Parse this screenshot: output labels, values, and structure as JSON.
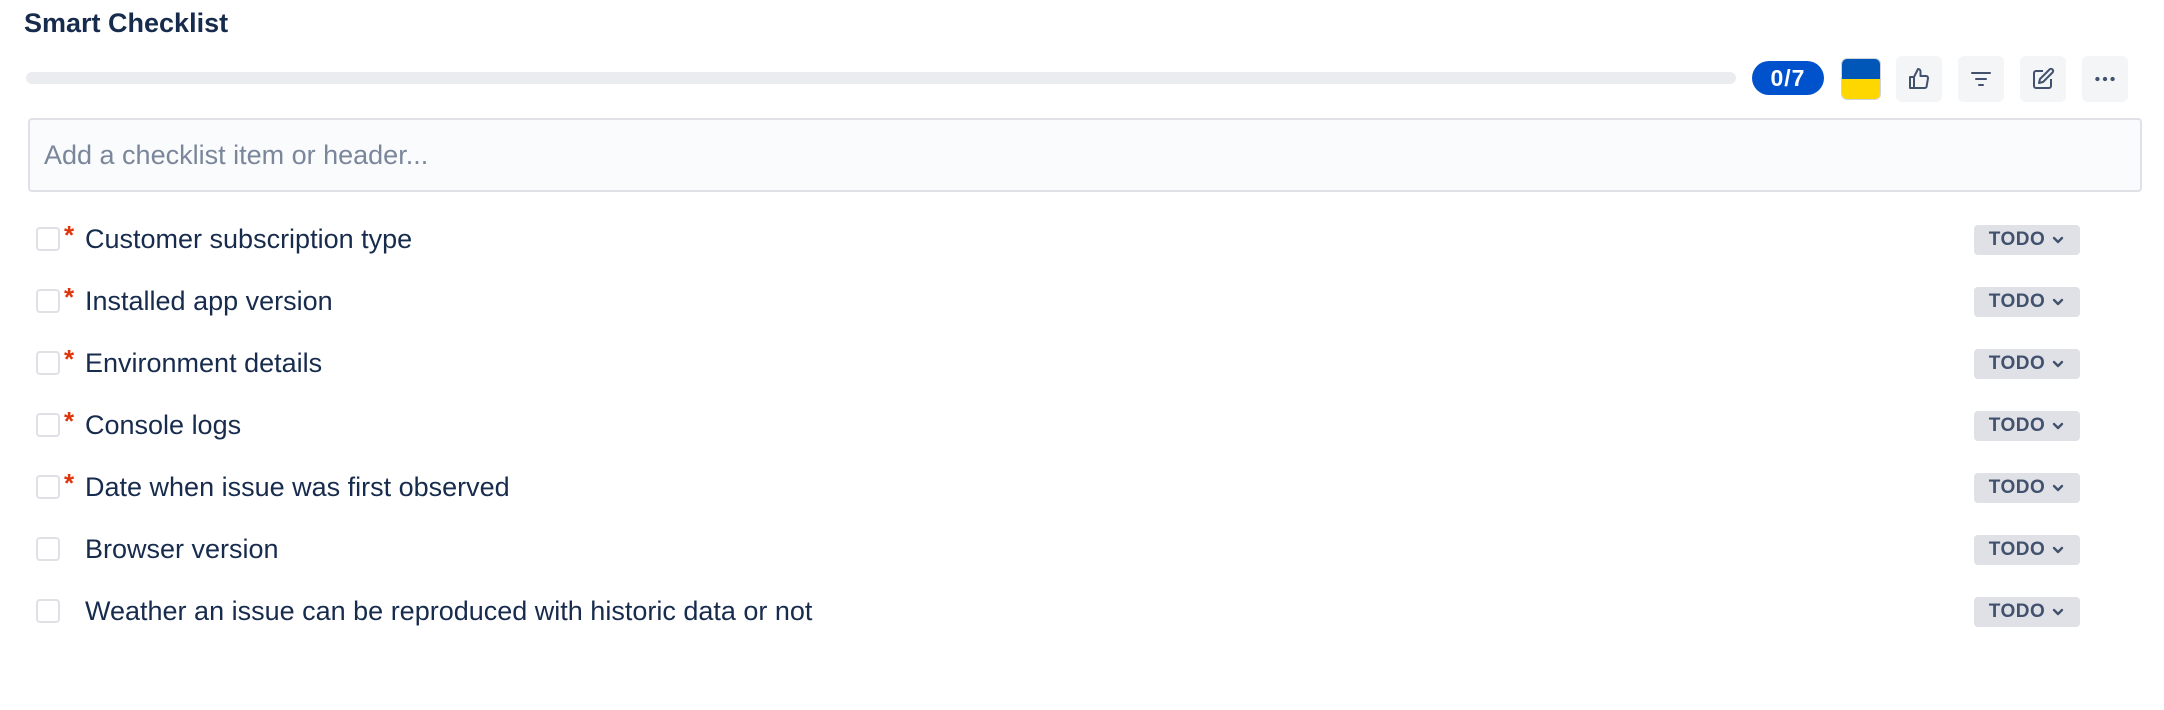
{
  "header": {
    "title": "Smart Checklist"
  },
  "toolbar": {
    "progress_fraction": 0,
    "count_label": "0/7",
    "progress_color": "#0052cc",
    "flag_colors": [
      "#0057b7",
      "#ffd700"
    ],
    "icons": [
      "thumbs-up-icon",
      "filter-icon",
      "edit-icon",
      "more-icon"
    ]
  },
  "add_item": {
    "placeholder": "Add a checklist item or header..."
  },
  "items": [
    {
      "label": "Customer subscription type",
      "required": true,
      "status": "TODO"
    },
    {
      "label": "Installed app version",
      "required": true,
      "status": "TODO"
    },
    {
      "label": "Environment details",
      "required": true,
      "status": "TODO"
    },
    {
      "label": "Console logs",
      "required": true,
      "status": "TODO"
    },
    {
      "label": "Date when issue was first observed",
      "required": true,
      "status": "TODO"
    },
    {
      "label": "Browser version",
      "required": false,
      "status": "TODO"
    },
    {
      "label": "Weather an issue can be reproduced with historic data or not",
      "required": false,
      "status": "TODO"
    }
  ],
  "required_marker": "*"
}
